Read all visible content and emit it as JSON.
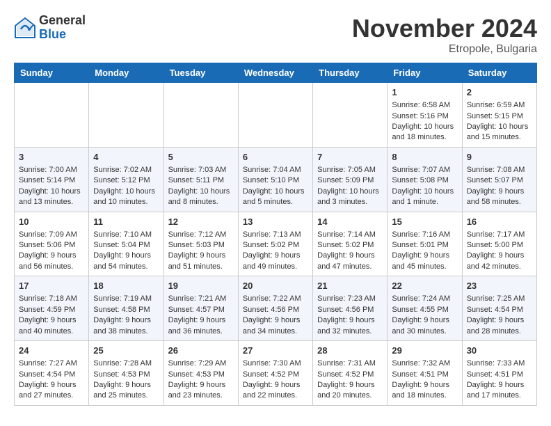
{
  "header": {
    "logo_general": "General",
    "logo_blue": "Blue",
    "month_title": "November 2024",
    "location": "Etropole, Bulgaria"
  },
  "days_of_week": [
    "Sunday",
    "Monday",
    "Tuesday",
    "Wednesday",
    "Thursday",
    "Friday",
    "Saturday"
  ],
  "weeks": [
    [
      {
        "day": "",
        "info": ""
      },
      {
        "day": "",
        "info": ""
      },
      {
        "day": "",
        "info": ""
      },
      {
        "day": "",
        "info": ""
      },
      {
        "day": "",
        "info": ""
      },
      {
        "day": "1",
        "info": "Sunrise: 6:58 AM\nSunset: 5:16 PM\nDaylight: 10 hours and 18 minutes."
      },
      {
        "day": "2",
        "info": "Sunrise: 6:59 AM\nSunset: 5:15 PM\nDaylight: 10 hours and 15 minutes."
      }
    ],
    [
      {
        "day": "3",
        "info": "Sunrise: 7:00 AM\nSunset: 5:14 PM\nDaylight: 10 hours and 13 minutes."
      },
      {
        "day": "4",
        "info": "Sunrise: 7:02 AM\nSunset: 5:12 PM\nDaylight: 10 hours and 10 minutes."
      },
      {
        "day": "5",
        "info": "Sunrise: 7:03 AM\nSunset: 5:11 PM\nDaylight: 10 hours and 8 minutes."
      },
      {
        "day": "6",
        "info": "Sunrise: 7:04 AM\nSunset: 5:10 PM\nDaylight: 10 hours and 5 minutes."
      },
      {
        "day": "7",
        "info": "Sunrise: 7:05 AM\nSunset: 5:09 PM\nDaylight: 10 hours and 3 minutes."
      },
      {
        "day": "8",
        "info": "Sunrise: 7:07 AM\nSunset: 5:08 PM\nDaylight: 10 hours and 1 minute."
      },
      {
        "day": "9",
        "info": "Sunrise: 7:08 AM\nSunset: 5:07 PM\nDaylight: 9 hours and 58 minutes."
      }
    ],
    [
      {
        "day": "10",
        "info": "Sunrise: 7:09 AM\nSunset: 5:06 PM\nDaylight: 9 hours and 56 minutes."
      },
      {
        "day": "11",
        "info": "Sunrise: 7:10 AM\nSunset: 5:04 PM\nDaylight: 9 hours and 54 minutes."
      },
      {
        "day": "12",
        "info": "Sunrise: 7:12 AM\nSunset: 5:03 PM\nDaylight: 9 hours and 51 minutes."
      },
      {
        "day": "13",
        "info": "Sunrise: 7:13 AM\nSunset: 5:02 PM\nDaylight: 9 hours and 49 minutes."
      },
      {
        "day": "14",
        "info": "Sunrise: 7:14 AM\nSunset: 5:02 PM\nDaylight: 9 hours and 47 minutes."
      },
      {
        "day": "15",
        "info": "Sunrise: 7:16 AM\nSunset: 5:01 PM\nDaylight: 9 hours and 45 minutes."
      },
      {
        "day": "16",
        "info": "Sunrise: 7:17 AM\nSunset: 5:00 PM\nDaylight: 9 hours and 42 minutes."
      }
    ],
    [
      {
        "day": "17",
        "info": "Sunrise: 7:18 AM\nSunset: 4:59 PM\nDaylight: 9 hours and 40 minutes."
      },
      {
        "day": "18",
        "info": "Sunrise: 7:19 AM\nSunset: 4:58 PM\nDaylight: 9 hours and 38 minutes."
      },
      {
        "day": "19",
        "info": "Sunrise: 7:21 AM\nSunset: 4:57 PM\nDaylight: 9 hours and 36 minutes."
      },
      {
        "day": "20",
        "info": "Sunrise: 7:22 AM\nSunset: 4:56 PM\nDaylight: 9 hours and 34 minutes."
      },
      {
        "day": "21",
        "info": "Sunrise: 7:23 AM\nSunset: 4:56 PM\nDaylight: 9 hours and 32 minutes."
      },
      {
        "day": "22",
        "info": "Sunrise: 7:24 AM\nSunset: 4:55 PM\nDaylight: 9 hours and 30 minutes."
      },
      {
        "day": "23",
        "info": "Sunrise: 7:25 AM\nSunset: 4:54 PM\nDaylight: 9 hours and 28 minutes."
      }
    ],
    [
      {
        "day": "24",
        "info": "Sunrise: 7:27 AM\nSunset: 4:54 PM\nDaylight: 9 hours and 27 minutes."
      },
      {
        "day": "25",
        "info": "Sunrise: 7:28 AM\nSunset: 4:53 PM\nDaylight: 9 hours and 25 minutes."
      },
      {
        "day": "26",
        "info": "Sunrise: 7:29 AM\nSunset: 4:53 PM\nDaylight: 9 hours and 23 minutes."
      },
      {
        "day": "27",
        "info": "Sunrise: 7:30 AM\nSunset: 4:52 PM\nDaylight: 9 hours and 22 minutes."
      },
      {
        "day": "28",
        "info": "Sunrise: 7:31 AM\nSunset: 4:52 PM\nDaylight: 9 hours and 20 minutes."
      },
      {
        "day": "29",
        "info": "Sunrise: 7:32 AM\nSunset: 4:51 PM\nDaylight: 9 hours and 18 minutes."
      },
      {
        "day": "30",
        "info": "Sunrise: 7:33 AM\nSunset: 4:51 PM\nDaylight: 9 hours and 17 minutes."
      }
    ]
  ]
}
